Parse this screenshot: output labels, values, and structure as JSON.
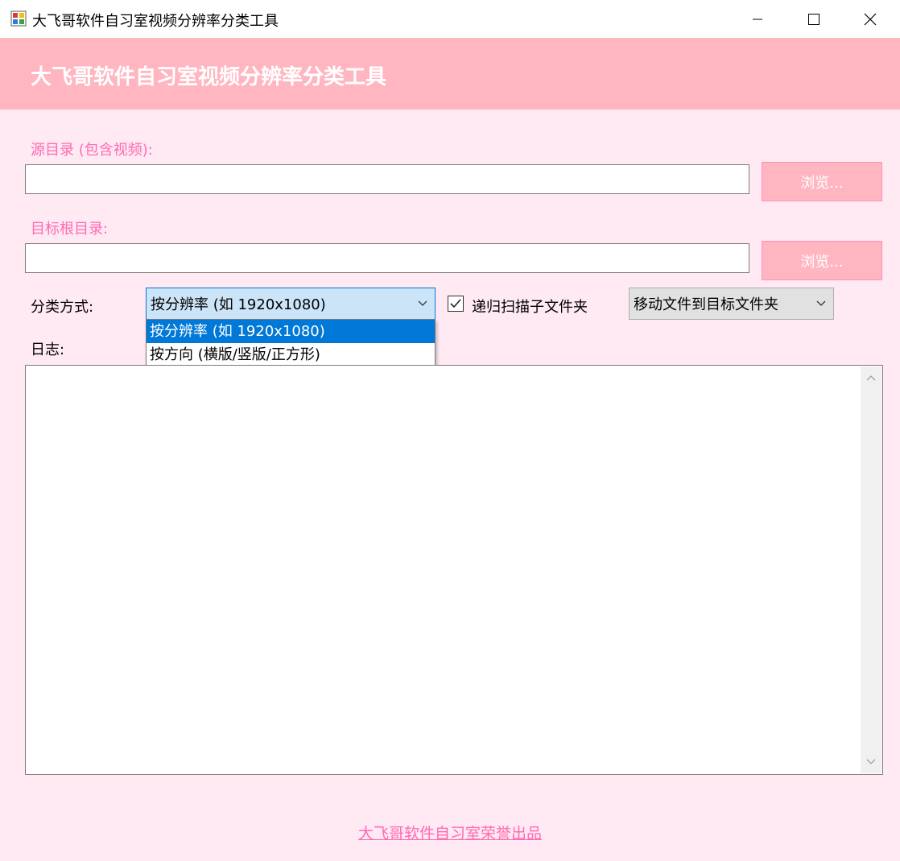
{
  "window": {
    "title": "大飞哥软件自习室视频分辨率分类工具"
  },
  "header": {
    "title": "大飞哥软件自习室视频分辨率分类工具"
  },
  "source": {
    "label": "源目录 (包含视频):",
    "value": "",
    "browse_label": "浏览..."
  },
  "target": {
    "label": "目标根目录:",
    "value": "",
    "browse_label": "浏览..."
  },
  "classify": {
    "label": "分类方式:",
    "selected": "按分辨率 (如 1920x1080)",
    "options": [
      "按分辨率 (如 1920x1080)",
      "按方向 (横版/竖版/正方形)"
    ]
  },
  "recursive": {
    "label": "递归扫描子文件夹",
    "checked": true
  },
  "action": {
    "selected": "移动文件到目标文件夹"
  },
  "log": {
    "label": "日志:",
    "content": ""
  },
  "footer": {
    "link": "大飞哥软件自习室荣誉出品"
  },
  "colors": {
    "accent_pink": "#ff69b4",
    "header_band": "#ffb6c1",
    "background": "#ffe9f2",
    "selection_blue": "#0078d7"
  }
}
